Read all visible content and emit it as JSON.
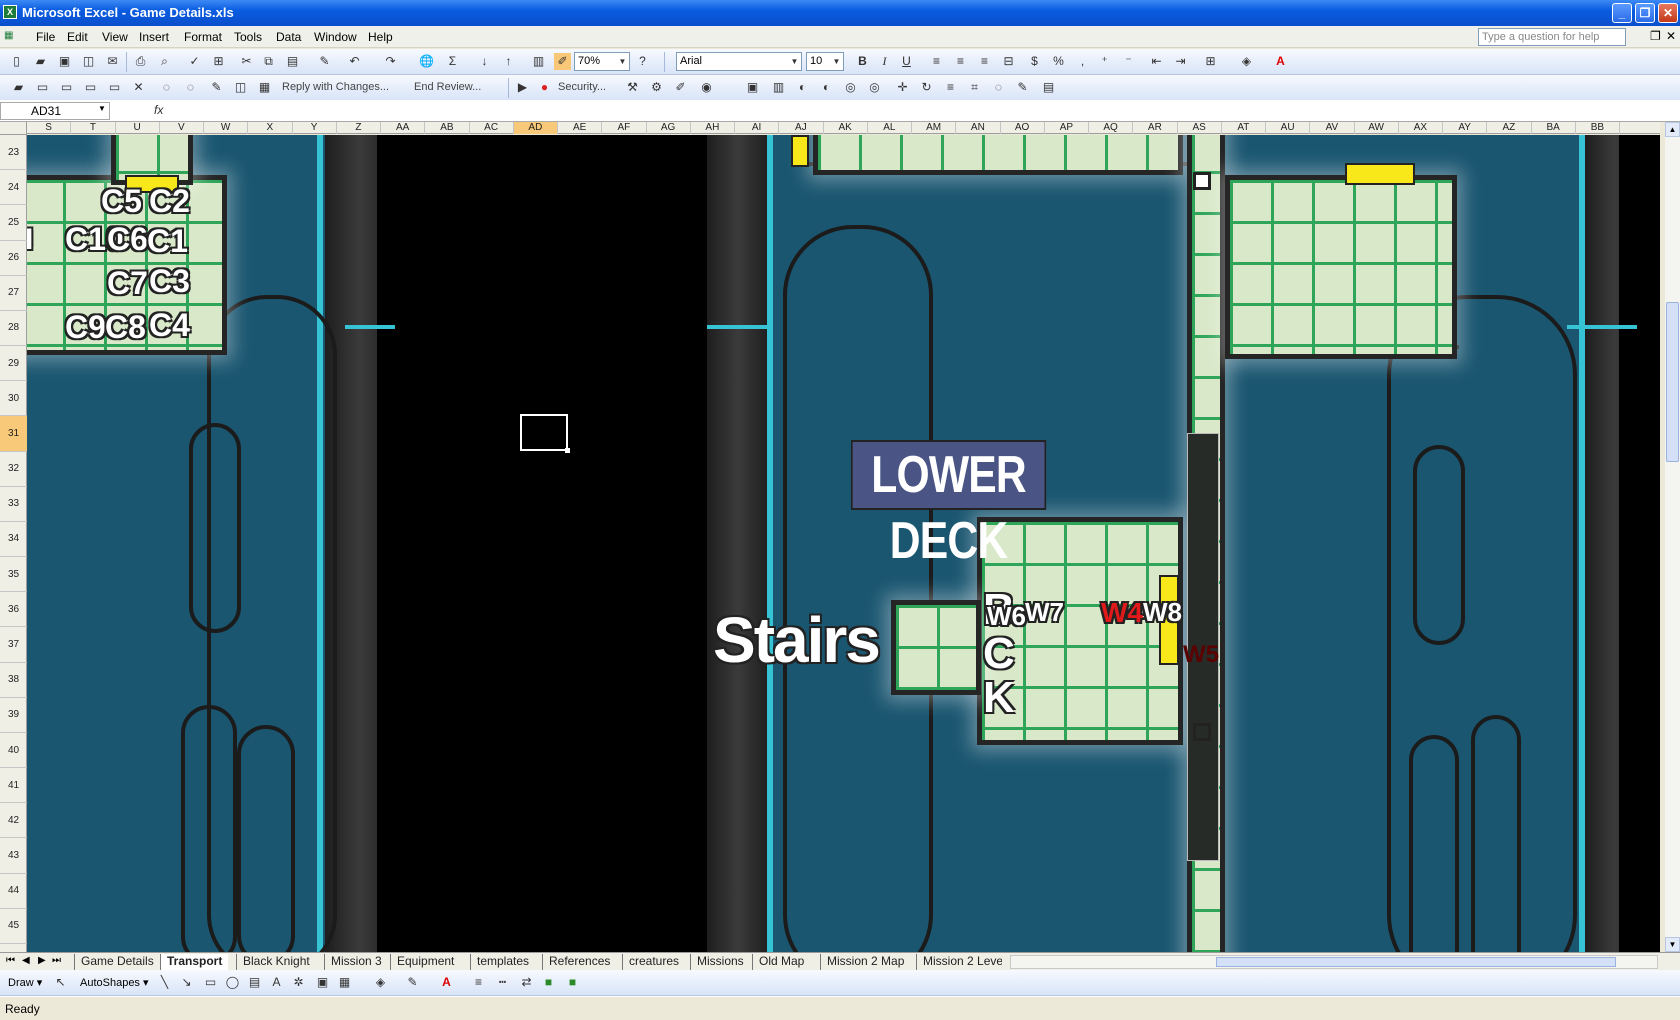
{
  "window": {
    "title": "Microsoft Excel - Game Details.xls"
  },
  "menu": [
    "File",
    "Edit",
    "View",
    "Insert",
    "Format",
    "Tools",
    "Data",
    "Window",
    "Help"
  ],
  "help_placeholder": "Type a question for help",
  "toolbar": {
    "zoom": "70%",
    "font": "Arial",
    "size": "10",
    "bold": "B",
    "italic": "I",
    "underline": "U",
    "percent": "%",
    "comma": ",",
    "reply": "Reply with Changes...",
    "end_review": "End Review...",
    "security": "Security..."
  },
  "formula": {
    "cell": "AD31",
    "fx": "fx",
    "content": ""
  },
  "columns": [
    "S",
    "T",
    "U",
    "V",
    "W",
    "X",
    "Y",
    "Z",
    "AA",
    "AB",
    "AC",
    "AD",
    "AE",
    "AF",
    "AG",
    "AH",
    "AI",
    "AJ",
    "AK",
    "AL",
    "AM",
    "AN",
    "AO",
    "AP",
    "AQ",
    "AR",
    "AS",
    "AT",
    "AU",
    "AV",
    "AW",
    "AX",
    "AY",
    "AZ",
    "BA",
    "BB"
  ],
  "selected_column": "AD",
  "rows": [
    "23",
    "24",
    "25",
    "26",
    "27",
    "28",
    "29",
    "30",
    "31",
    "32",
    "33",
    "34",
    "35",
    "36",
    "37",
    "38",
    "39",
    "40",
    "41",
    "42",
    "43",
    "44",
    "45"
  ],
  "selected_row": "31",
  "map": {
    "deck_title": "LOWER DECK",
    "stairs": "Stairs",
    "crates": [
      "C5",
      "C2",
      "C10",
      "C6",
      "C1",
      "C7",
      "C3",
      "C9",
      "C8",
      "C4"
    ],
    "left_mark": "I",
    "back_letters": [
      "B",
      "C",
      "K"
    ],
    "weapons": [
      "W6",
      "W7",
      "W4",
      "W8",
      "W5"
    ],
    "accent": "#f8e81a"
  },
  "tabs": [
    "Game Details",
    "Transport",
    "Black Knight",
    "Mission 3",
    "Equipment",
    "templates",
    "References",
    "creatures",
    "Missions",
    "Old Map",
    "Mission 2 Map",
    "Mission 2 Leve"
  ],
  "active_tab": "Transport",
  "drawbar": {
    "draw": "Draw ▾",
    "autoshapes": "AutoShapes ▾"
  },
  "status": "Ready"
}
